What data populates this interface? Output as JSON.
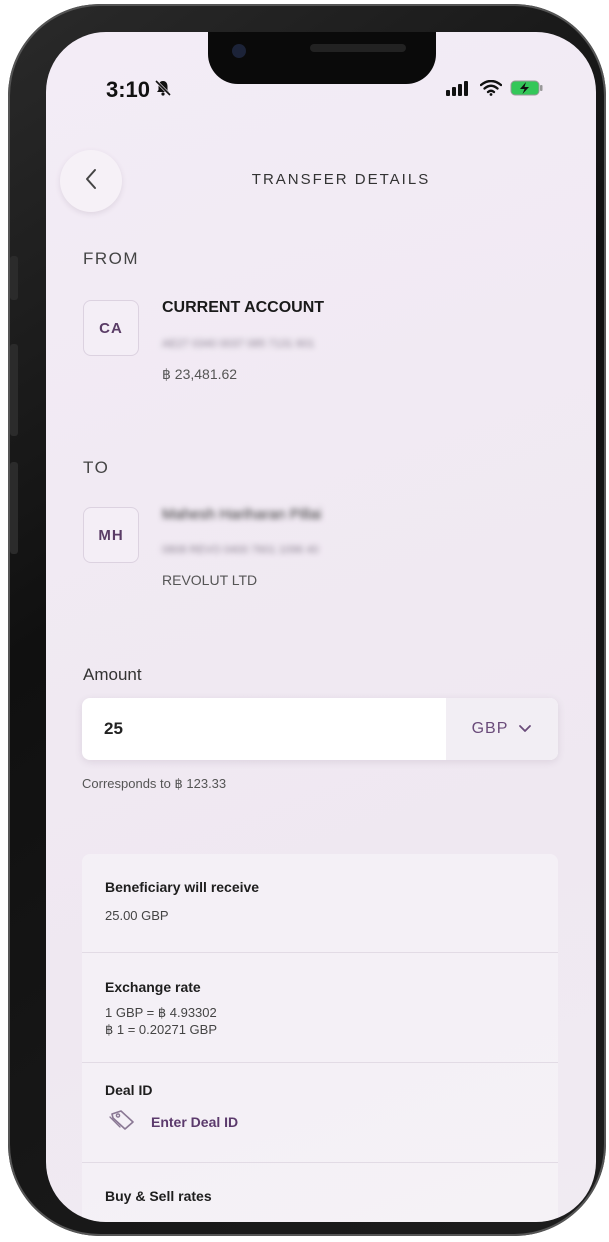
{
  "status_bar": {
    "time": "3:10",
    "mute_icon": "bell-slash-icon",
    "signal_icon": "signal-icon",
    "wifi_icon": "wifi-icon",
    "battery_icon": "battery-charging-icon"
  },
  "header": {
    "title": "TRANSFER DETAILS",
    "back_icon": "chevron-left-icon"
  },
  "from": {
    "section_label": "FROM",
    "initials": "CA",
    "name": "CURRENT ACCOUNT",
    "account_number": "AE27 0340 0037 085 7131 601",
    "balance": "฿ 23,481.62"
  },
  "to": {
    "section_label": "TO",
    "initials": "MH",
    "name": "Mahesh Hariharan Pillai",
    "account_number": "0808 REVO 0400 7601 1096 40",
    "bank": "REVOLUT LTD"
  },
  "amount": {
    "label": "Amount",
    "value": "25",
    "currency": "GBP",
    "corresponds": "Corresponds to ฿ 123.33"
  },
  "summary": {
    "beneficiary_title": "Beneficiary will receive",
    "beneficiary_value": "25.00 GBP",
    "exchange_title": "Exchange rate",
    "exchange_line1": "1 GBP = ฿ 4.93302",
    "exchange_line2": "฿ 1 = 0.20271 GBP",
    "deal_title": "Deal ID",
    "deal_link": "Enter Deal ID",
    "buy_sell_title": "Buy & Sell rates"
  },
  "colors": {
    "accent": "#5b3a6c",
    "background": "#f1eaf3"
  }
}
